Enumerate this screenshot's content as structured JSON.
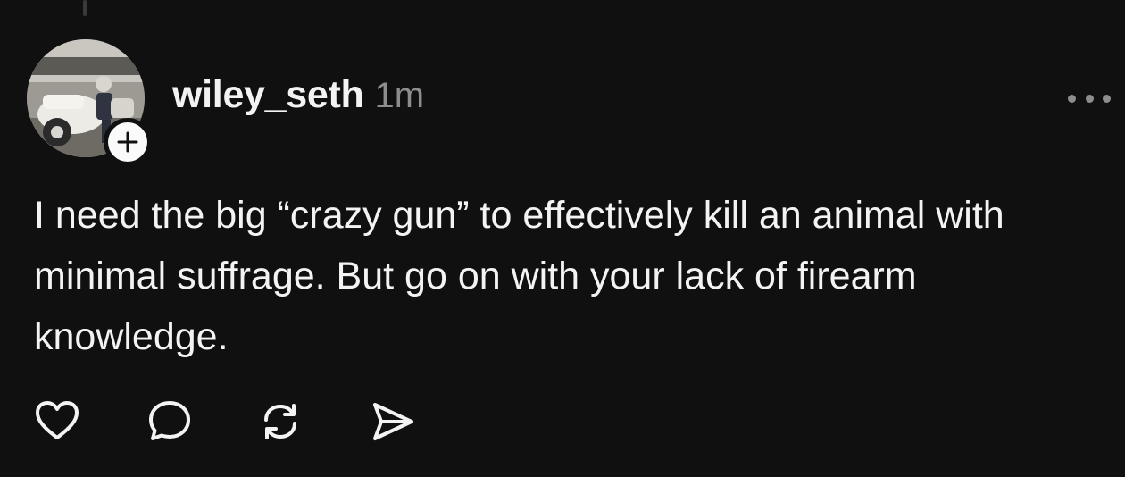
{
  "post": {
    "username": "wiley_seth",
    "timestamp": "1m",
    "text": "I need the big “crazy gun” to effectively kill an animal with minimal suffrage. But go on with your lack of firearm knowledge."
  },
  "icons": {
    "follow": "plus-icon",
    "more": "more-horizontal-icon",
    "like": "heart-icon",
    "reply": "comment-icon",
    "repost": "repost-icon",
    "share": "send-icon"
  },
  "colors": {
    "background": "#101010",
    "text": "#f3f3f3",
    "muted": "#8d8d8d"
  }
}
